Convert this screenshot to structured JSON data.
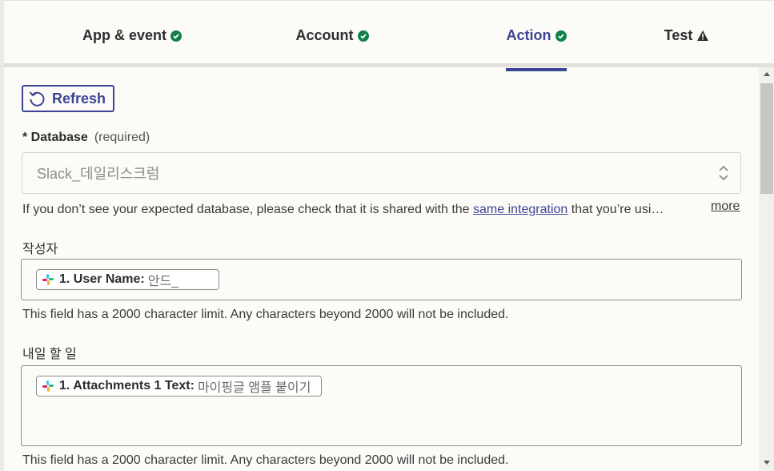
{
  "tabs": [
    {
      "label": "App & event",
      "status": "complete"
    },
    {
      "label": "Account",
      "status": "complete"
    },
    {
      "label": "Action",
      "status": "complete",
      "active": true
    },
    {
      "label": "Test",
      "status": "warning"
    }
  ],
  "refresh_label": "Refresh",
  "database": {
    "asterisk": "* ",
    "label": "Database",
    "required_text": "(required)",
    "value": "Slack_데일리스크럼",
    "help_text": "If you don’t see your expected database, please check that it is shared with the ",
    "help_link": "same integration",
    "help_suffix": " that you’re usi…",
    "more_label": "more"
  },
  "fields": [
    {
      "label": "작성자",
      "pill_key": "1. User Name:",
      "pill_value": "안드_",
      "help": "This field has a 2000 character limit. Any characters beyond 2000 will not be included."
    },
    {
      "label": "내일 할 일",
      "pill_key": "1. Attachments 1 Text:",
      "pill_value": "마이핑글 앰플 붙이기",
      "help": "This field has a 2000 character limit. Any characters beyond 2000 will not be included."
    }
  ],
  "colors": {
    "accent": "#3d4592",
    "success": "#13804a",
    "background": "#fcfbf8"
  }
}
